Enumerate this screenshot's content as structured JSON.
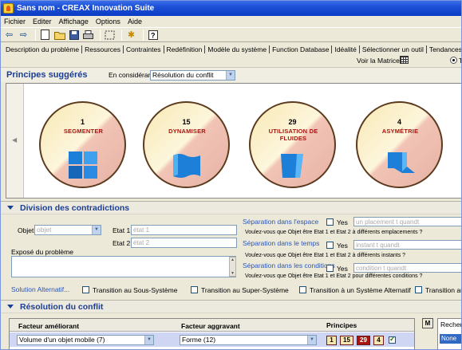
{
  "window": {
    "title": "Sans nom - CREAX Innovation Suite"
  },
  "menu": [
    "Fichier",
    "Editer",
    "Affichage",
    "Options",
    "Aide"
  ],
  "toolbar_icons": [
    "back-icon",
    "forward-icon",
    "new-doc-icon",
    "open-folder-icon",
    "save-icon",
    "print-icon",
    "select-frame-icon",
    "tip-icon",
    "help-icon"
  ],
  "tabs": [
    "Description du problème",
    "Ressources",
    "Contraintes",
    "Redéfinition",
    "Modèle du système",
    "Function Database",
    "Idéalité",
    "Sélectionner un outil",
    "Tendances d'évolution"
  ],
  "matrix": {
    "label": "Voir la Matrice",
    "radio_text": "T"
  },
  "principes": {
    "title": "Principes suggérés",
    "considering_label": "En considérant",
    "considering_value": "Résolution du conflit",
    "items": [
      {
        "num": "1",
        "name": "SEGMENTER",
        "icon": "segment-squares-icon"
      },
      {
        "num": "15",
        "name": "DYNAMISER",
        "icon": "flexible-sheet-icon"
      },
      {
        "num": "29",
        "name": "UTILISATION DE FLUIDES",
        "icon": "fluid-sheet-icon"
      },
      {
        "num": "4",
        "name": "ASYMÉTRIE",
        "icon": "asymmetric-shape-icon"
      }
    ]
  },
  "division": {
    "title": "Division des contradictions",
    "objet_label": "Objet",
    "objet_placeholder": "objet",
    "etat1_label": "Etat 1",
    "etat1_placeholder": "état 1",
    "etat2_label": "Etat 2",
    "etat2_placeholder": "état 2",
    "expose_label": "Exposé du problème",
    "separations": [
      {
        "title": "Séparation dans l'espace",
        "yes": "Yes",
        "placeholder": "un placement t quandt",
        "question": "Voulez-vous que  Objet être Etat 1 et Etat 2 à différents emplacements ?"
      },
      {
        "title": "Séparation dans le temps",
        "yes": "Yes",
        "placeholder": "instant t quandt",
        "question": "Voulez-vous que  Objet être Etat 1 et Etat 2 à différents instants ?"
      },
      {
        "title": "Séparation dans les conditions",
        "yes": "Yes",
        "placeholder": "condition t quandt",
        "question": "Voulez-vous que  Objet être Etat 1 et Etat 2 pour différentes conditions ?"
      }
    ],
    "solution_label": "Solution Alternatif...",
    "transitions": [
      "Transition au Sous-Système",
      "Transition au Super-Système",
      "Transition à un Système Alternatif",
      "Transition au S"
    ]
  },
  "resolution": {
    "title": "Résolution du conflit",
    "col_ameliorant": "Facteur améliorant",
    "col_aggravant": "Facteur aggravant",
    "col_principes": "Principes",
    "ameliorant_value": "Volume d'un objet mobile (7)",
    "aggravant_value": "Forme (12)",
    "principe_values": [
      "1",
      "15",
      "29",
      "4"
    ],
    "side_button": "M",
    "side_label": "Recher",
    "side_value": "None"
  },
  "colors": {
    "title_blue": "#0b3bc4",
    "section_blue": "#1c3d94",
    "principle_red": "#a8140f",
    "icon_blue": "#1e7fd8"
  }
}
